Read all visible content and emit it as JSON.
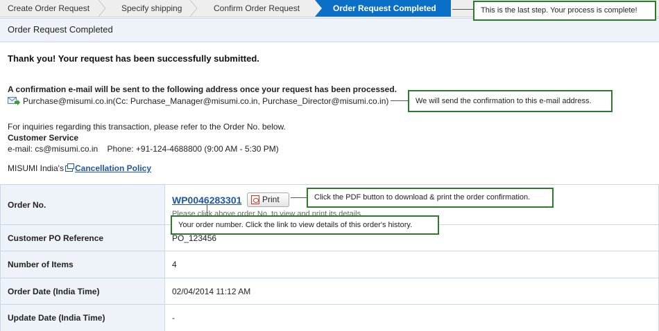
{
  "steps": [
    {
      "label": "Create Order Request",
      "state": "done"
    },
    {
      "label": "Specify shipping",
      "state": "done"
    },
    {
      "label": "Confirm Order Request",
      "state": "done"
    },
    {
      "label": "Order Request Completed",
      "state": "active"
    }
  ],
  "page": {
    "title": "Order Request Completed",
    "thank_you": "Thank you! Your request has been successfully submitted.",
    "confirmation_heading": "A confirmation e-mail will be sent to the following address once your request has been processed.",
    "confirmation_email": "Purchase@misumi.co.in(Cc: Purchase_Manager@misumi.co.in, Purchase_Director@misumi.co.in)",
    "inquiry_text": "For inquiries regarding this transaction, please refer to the Order No. below.",
    "customer_service_title": "Customer Service",
    "customer_service_contact": "e-mail: cs@misumi.co.in    Phone: +91-124-4688800 (9:00 AM - 5:30 PM)",
    "cancellation_prefix": "MISUMI India's",
    "cancellation_link": "Cancellation Policy"
  },
  "order": {
    "rows": {
      "order_no": {
        "label": "Order No.",
        "value": "WP0046283301",
        "print_label": "Print",
        "note": "Please click above order No. to view and print its details."
      },
      "po_ref": {
        "label": "Customer PO Reference",
        "value": "PO_123456"
      },
      "items": {
        "label": "Number of Items",
        "value": "4"
      },
      "order_date": {
        "label": "Order Date (India Time)",
        "value": "02/04/2014 11:12 AM"
      },
      "update_date": {
        "label": "Update Date (India Time)",
        "value": "-"
      }
    }
  },
  "callouts": {
    "last_step": "This is the last step. Your process is complete!",
    "email": "We will send the confirmation to this e-mail address.",
    "pdf": "Click the PDF button to download & print the order confirmation.",
    "order_number": "Your order number. Click the link to view details of this order's history."
  },
  "icons": [
    "mail-forward-icon",
    "new-window-icon",
    "pdf-icon"
  ],
  "colors": {
    "accent": "#0a6fc6",
    "link": "#1f56a5",
    "callout_border": "#2c7a2c",
    "band": "#eef3f9"
  }
}
